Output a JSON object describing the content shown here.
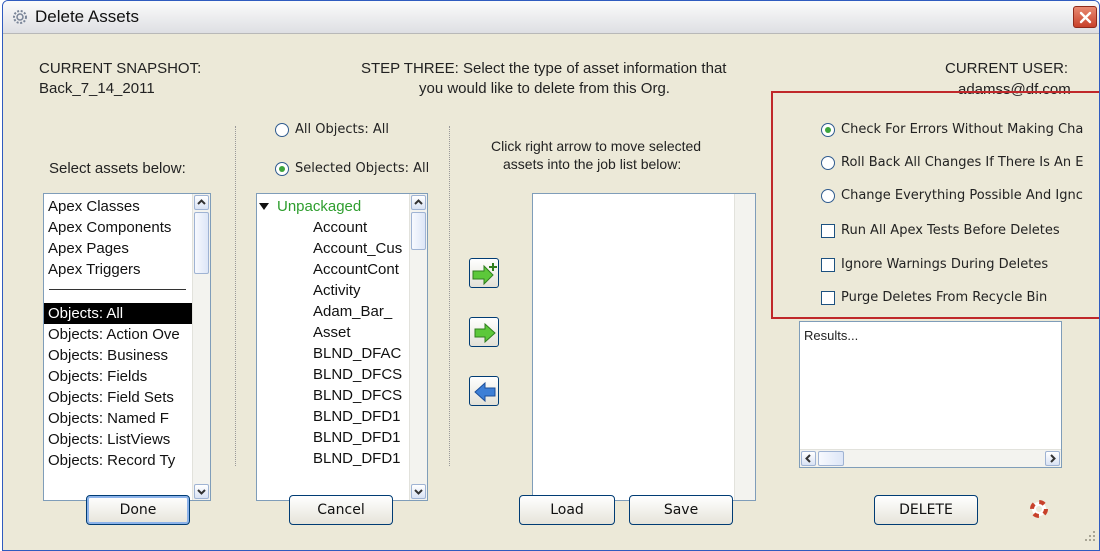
{
  "window": {
    "title": "Delete Assets",
    "icon": "gear-icon",
    "close": "close-icon"
  },
  "snapshot": {
    "label": "CURRENT SNAPSHOT:",
    "value": "Back_7_14_2011"
  },
  "step": {
    "line1": "STEP THREE: Select the type of asset information that",
    "line2": "you would like to delete from this Org."
  },
  "user": {
    "label": "CURRENT USER:",
    "value": "adamss@df.com"
  },
  "assets": {
    "prompt": "Select assets below:",
    "types": [
      "Apex Classes",
      "Apex Components",
      "Apex Pages",
      "Apex Triggers"
    ],
    "objects": [
      "Objects: All",
      "Objects: Action Ove",
      "Objects: Business",
      "Objects: Fields",
      "Objects: Field Sets",
      "Objects: Named F",
      "Objects: ListViews",
      "Objects: Record Ty"
    ]
  },
  "objects_filter": {
    "all": "All Objects: All",
    "selected": "Selected Objects: All"
  },
  "tree": {
    "root": "Unpackaged",
    "items": [
      "Account",
      "Account_Cus",
      "AccountCont",
      "Activity",
      "Adam_Bar_",
      "Asset",
      "BLND_DFAC",
      "BLND_DFCS",
      "BLND_DFCS",
      "BLND_DFD1",
      "BLND_DFD1",
      "BLND_DFD1"
    ]
  },
  "job": {
    "instructions_line1": "Click right arrow to move selected",
    "instructions_line2": "assets into the job list below:"
  },
  "options": {
    "radios": [
      "Check For Errors Without Making Cha",
      "Roll Back All Changes If There Is An E",
      "Change Everything Possible And Ignc"
    ],
    "checks": [
      "Run All Apex Tests Before Deletes",
      "Ignore Warnings During Deletes",
      "Purge Deletes From Recycle Bin"
    ]
  },
  "results": {
    "text": "Results..."
  },
  "buttons": {
    "done": "Done",
    "cancel": "Cancel",
    "load": "Load",
    "save": "Save",
    "delete": "DELETE"
  },
  "colors": {
    "highlight_box": "#c0282a",
    "tree_root": "#2e9e2e",
    "arrow_green": "#5cc83a",
    "arrow_blue": "#3d7fd6"
  }
}
